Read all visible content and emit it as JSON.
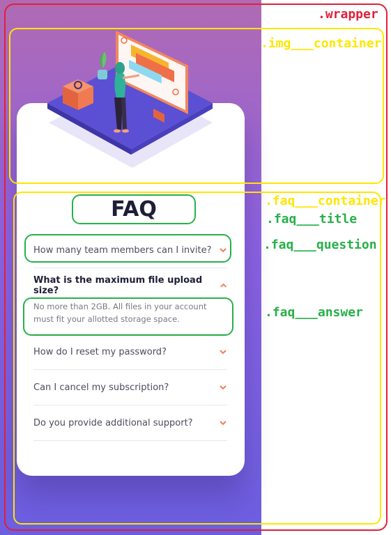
{
  "faq": {
    "title": "FAQ",
    "items": [
      {
        "question": "How many team members can I invite?",
        "answer": ""
      },
      {
        "question": "What is the maximum file upload size?",
        "answer": "No more than 2GB. All files in your account must fit your allotted storage space."
      },
      {
        "question": "How do I reset my password?",
        "answer": ""
      },
      {
        "question": "Can I cancel my subscription?",
        "answer": ""
      },
      {
        "question": "Do you provide additional support?",
        "answer": ""
      }
    ],
    "open_index": 1
  },
  "annotations": {
    "wrapper": ".wrapper",
    "img_container": ".img___container",
    "faq_container": ".faq___container",
    "faq_title": ".faq___title",
    "faq_question": ".faq___question",
    "faq_answer": ".faq___answer"
  },
  "colors": {
    "accent": "#f47b56",
    "title": "#1e1f36",
    "wrapper_outline": "#e0203a",
    "container_outline": "#ffe600",
    "element_outline": "#28b04a"
  }
}
